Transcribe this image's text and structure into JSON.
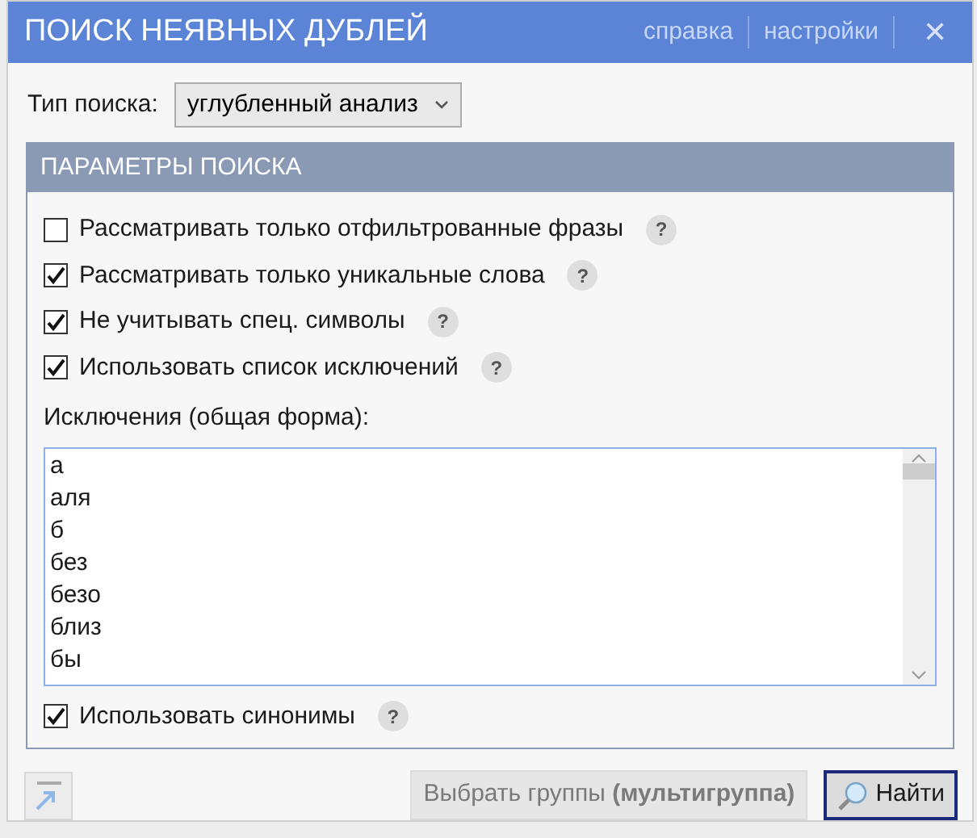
{
  "window": {
    "title": "ПОИСК НЕЯВНЫХ ДУБЛЕЙ",
    "links": [
      "справка",
      "настройки"
    ],
    "close": "✕"
  },
  "search_type": {
    "label": "Тип поиска:",
    "value": "углубленный анализ"
  },
  "params": {
    "title": "ПАРАМЕТРЫ ПОИСКА",
    "options": [
      {
        "label": "Рассматривать только отфильтрованные фразы",
        "checked": false,
        "help": "?"
      },
      {
        "label": "Рассматривать только уникальные слова",
        "checked": true,
        "help": "?"
      },
      {
        "label": "Не учитывать спец. символы",
        "checked": true,
        "help": "?"
      },
      {
        "label": "Использовать список исключений",
        "checked": true,
        "help": "?"
      }
    ],
    "exclusions_label": "Исключения (общая форма):",
    "exclusions": [
      "а",
      "аля",
      "б",
      "без",
      "безо",
      "близ",
      "бы"
    ],
    "synonyms": {
      "label": "Использовать синонимы",
      "checked": true,
      "help": "?"
    }
  },
  "buttons": [
    {
      "kind": "secondary",
      "label": "Выбрать группы **(мультигруппа)**",
      "disabled": true
    },
    {
      "kind": "primary",
      "label": "Найти",
      "disabled": false
    }
  ]
}
